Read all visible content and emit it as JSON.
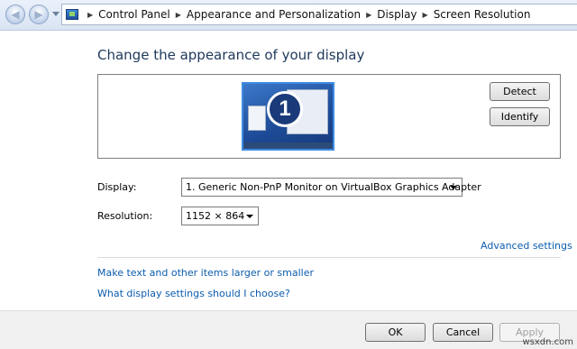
{
  "addressbar": {
    "back_icon": "back-arrow-icon",
    "forward_icon": "forward-arrow-icon",
    "crumbs": [
      "Control Panel",
      "Appearance and Personalization",
      "Display",
      "Screen Resolution"
    ]
  },
  "main": {
    "heading": "Change the appearance of your display",
    "monitor_number": "1",
    "detect_label": "Detect",
    "identify_label": "Identify",
    "display_label": "Display:",
    "display_value": "1. Generic Non-PnP Monitor on VirtualBox Graphics Adapter",
    "resolution_label": "Resolution:",
    "resolution_value": "1152 × 864",
    "advanced_link": "Advanced settings",
    "link_text_size": "Make text and other items larger or smaller",
    "link_help": "What display settings should I choose?"
  },
  "footer": {
    "ok_label": "OK",
    "cancel_label": "Cancel",
    "apply_label": "Apply"
  },
  "watermark": "wsxdn.com"
}
